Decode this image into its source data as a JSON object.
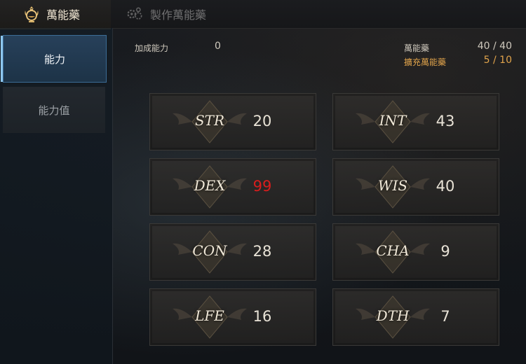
{
  "tabs": [
    {
      "label": "萬能藥",
      "icon": "potion-crest-icon",
      "active": true
    },
    {
      "label": "製作萬能藥",
      "icon": "crafting-gears-icon",
      "active": false
    }
  ],
  "sidebar": {
    "items": [
      {
        "label": "能力",
        "active": true
      },
      {
        "label": "能力值",
        "active": false
      }
    ]
  },
  "info": {
    "bonus_label": "加成能力",
    "bonus_value": "0",
    "potion_label": "萬能藥",
    "potion_value": "40 / 40",
    "expand_label": "擴充萬能藥",
    "expand_value": "5 / 10"
  },
  "stats": [
    {
      "name": "STR",
      "value": "20"
    },
    {
      "name": "INT",
      "value": "43"
    },
    {
      "name": "DEX",
      "value": "99",
      "highlight": true
    },
    {
      "name": "WIS",
      "value": "40"
    },
    {
      "name": "CON",
      "value": "28"
    },
    {
      "name": "CHA",
      "value": "9"
    },
    {
      "name": "LFE",
      "value": "16"
    },
    {
      "name": "DTH",
      "value": "7"
    }
  ],
  "colors": {
    "accent_gold": "#b89a5a",
    "expand_orange": "#e0a34b",
    "highlight_red": "#d81d1d",
    "sidebar_active": "#27405a"
  }
}
